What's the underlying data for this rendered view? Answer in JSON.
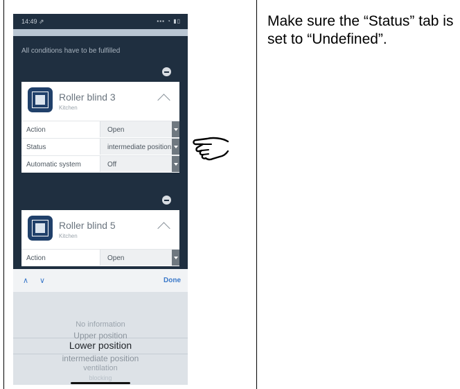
{
  "statusbar": {
    "time": "14:49 ⇗",
    "icons": "▪▪▪ ◔ ▮▯"
  },
  "conditions_note": "All conditions have to be fulfilled",
  "cards": [
    {
      "name": "Roller blind 3",
      "room": "Kitchen",
      "rows": [
        {
          "label": "Action",
          "value": "Open"
        },
        {
          "label": "Status",
          "value": "intermediate position"
        },
        {
          "label": "Automatic system",
          "value": "Off"
        }
      ]
    },
    {
      "name": "Roller blind 5",
      "room": "Kitchen",
      "rows": [
        {
          "label": "Action",
          "value": "Open"
        }
      ]
    }
  ],
  "toolbar": {
    "up": "∧",
    "down": "∨",
    "done": "Done"
  },
  "picker": {
    "options": [
      "No information",
      "Upper position",
      "Lower position",
      "intermediate position",
      "ventilation",
      "blocking"
    ],
    "selected_index": 2
  },
  "instruction": "Make sure the “Status” tab is set to “Undefined”.",
  "colors": {
    "app_bg": "#1f2f40",
    "accent": "#3a78c9",
    "icon_bg": "#20406a"
  }
}
